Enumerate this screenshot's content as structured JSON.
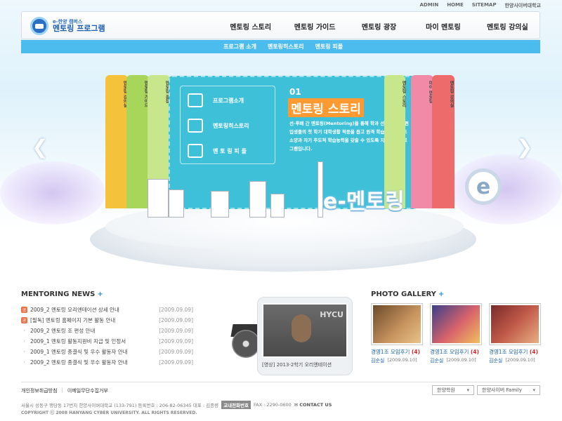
{
  "utility": [
    "ADMIN",
    "HOME",
    "SITEMAP",
    "한양사이버대학교"
  ],
  "logo": {
    "sub": "e-한양 캠퍼스",
    "main": "멘토링 프로그램"
  },
  "gnb": [
    "멘토링 스토리",
    "멘토링 가이드",
    "멘토링 광장",
    "마이 멘토링",
    "멘토링 강의실"
  ],
  "subnav": [
    "프로그램 소개",
    "멘토링히스토리",
    "멘토링 피플"
  ],
  "hero": {
    "tabs_left": [
      "멘토링 강의실",
      "멘토링 가이드",
      "멘토링 광장"
    ],
    "tabs_right": [
      "멘토링 스토리",
      "마이 멘토링",
      "멘토링 강의실"
    ],
    "board_menu": [
      "프로그램소개",
      "멘토링히스토리",
      "멘 토 링 피 플"
    ],
    "number": "01",
    "title": "멘토링 스토리",
    "description": "선·후배 간 멘토링(Mentoring)을 통해 학과 선배님이 신·편입생들의 첫 학기 대학생활 적응을 돕고 원격 학습자로서 기초 소양과 자기 주도적 학습능력을 갖출 수 있도록 지원하는 프로그램입니다.",
    "big_logo": "e-멘토링",
    "big_e": "e",
    "prev": "❮",
    "next": "❯"
  },
  "news": {
    "title": "MENTORING NEWS",
    "more": "+",
    "items": [
      {
        "badge": "공",
        "text": "2009_2 멘토링 오리엔테이션 상세 안내",
        "date": "[2009.09.09]"
      },
      {
        "badge": "공",
        "text": "[필독] 멘토링 홈페이지 기본 활동 안내",
        "date": "[2009.09.09]"
      },
      {
        "badge": "",
        "text": "2009_2 멘토링 조 편성 안내",
        "date": "[2009.09.09]"
      },
      {
        "badge": "",
        "text": "2009_1 멘토링 활동지원비 지급 및 인정서",
        "date": "[2009.09.09]"
      },
      {
        "badge": "",
        "text": "2009_1 멘토링 종결식 및 우수 활동자 안내",
        "date": "[2009.09.09]"
      },
      {
        "badge": "",
        "text": "2009_2 멘토링 종결식 및 우수 활동자 안내",
        "date": "[2009.09.09]"
      }
    ]
  },
  "video": {
    "logo": "HYCU",
    "caption": "[영상] 2013-2학기 오리엔테이션"
  },
  "gallery": {
    "title": "PHOTO GALLERY",
    "more": "+",
    "items": [
      {
        "caption": "경영1조 모임후기",
        "count": "(4)",
        "author": "김순실",
        "date": "[2009.09.10]"
      },
      {
        "caption": "경영1조 모임후기",
        "count": "(4)",
        "author": "김순실",
        "date": "[2009.09.10]"
      },
      {
        "caption": "경영1조 모임후기",
        "count": "(4)",
        "author": "김순실",
        "date": "[2009.09.10]"
      }
    ]
  },
  "footer": {
    "links": [
      "개인정보취급방침",
      "|",
      "이메일무단수집거부"
    ],
    "select1": "한양학원",
    "select2": "한양사이버 Family",
    "address": "서울시 성동구 행당동 17번지 한양사이버대학교 (133-791) 등록번호 : 206-82-06345 대표 : 김종량",
    "badge": "교내전화번호",
    "fax": "FAX : 2290-0600",
    "contact": "CONTACT US",
    "copyright": "COPYRIGHT ⓒ 2008 HANYANG CYBER UNIVERSITY. ALL RIGHTS RESERVED."
  },
  "colors": {
    "primary_blue": "#4cbbee",
    "board_cyan": "#3fc0d9",
    "orange_accent": "#ff9a33",
    "tab_yellow": "#f5c33b",
    "tab_green": "#a8d65a",
    "tab_lightgreen": "#c8e68c",
    "tab_pink": "#f08aa7",
    "tab_red": "#ee6b6b",
    "news_badge": "#e8734a",
    "gallery_red": "#d9272e"
  }
}
